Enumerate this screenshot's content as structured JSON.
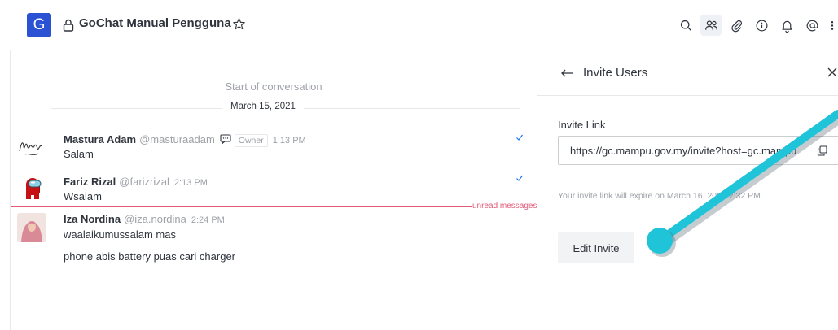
{
  "header": {
    "room_initial": "G",
    "room_title": "GoChat Manual Pengguna",
    "icons": [
      "search-icon",
      "members-icon",
      "attachment-icon",
      "info-icon",
      "bell-icon",
      "mention-icon",
      "kebab-menu-icon"
    ]
  },
  "conversation": {
    "start_text": "Start of conversation",
    "date": "March 15, 2021",
    "unread_label": "unread messages",
    "messages": [
      {
        "name": "Mastura Adam",
        "username": "@masturaadam",
        "role": "Owner",
        "time": "1:13 PM",
        "body": "Salam"
      },
      {
        "name": "Fariz Rizal",
        "username": "@farizrizal",
        "time": "2:13 PM",
        "body": "Wsalam"
      },
      {
        "name": "Iza Nordina",
        "username": "@iza.nordina",
        "time": "2:24 PM",
        "body": "waalaikumussalam mas",
        "followup": "phone abis battery puas cari charger"
      }
    ]
  },
  "panel": {
    "title": "Invite Users",
    "invite_label": "Invite Link",
    "invite_value": "https://gc.mampu.gov.my/invite?host=gc.mampu",
    "expire_text": "Your invite link will expire on March 16, 2021 2:32 PM.",
    "edit_button": "Edit Invite"
  },
  "colors": {
    "accent": "#2b52d3",
    "unread": "#e35a77",
    "annotation": "#1fc4d8"
  }
}
